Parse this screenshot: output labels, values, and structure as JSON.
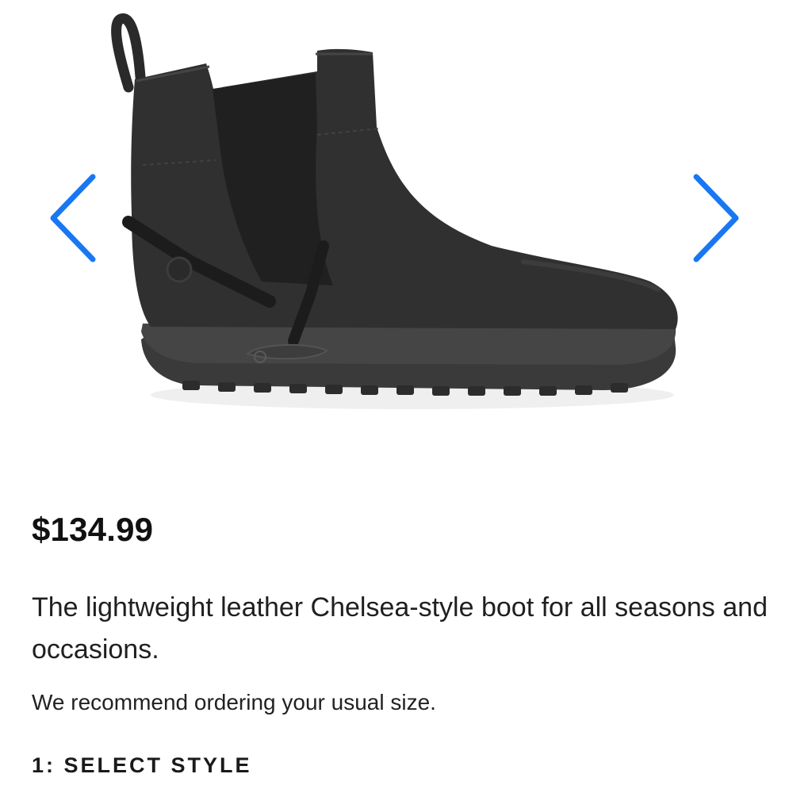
{
  "product": {
    "image_icon": "chelsea-boot-product-photo",
    "price": "$134.99",
    "description": "The lightweight leather Chelsea-style boot for all seasons and occasions.",
    "fit_note": "We recommend ordering your usual size.",
    "step_heading": "1: SELECT STYLE"
  },
  "carousel": {
    "prev_icon": "chevron-left-icon",
    "next_icon": "chevron-right-icon",
    "arrow_color": "#1877F2"
  }
}
